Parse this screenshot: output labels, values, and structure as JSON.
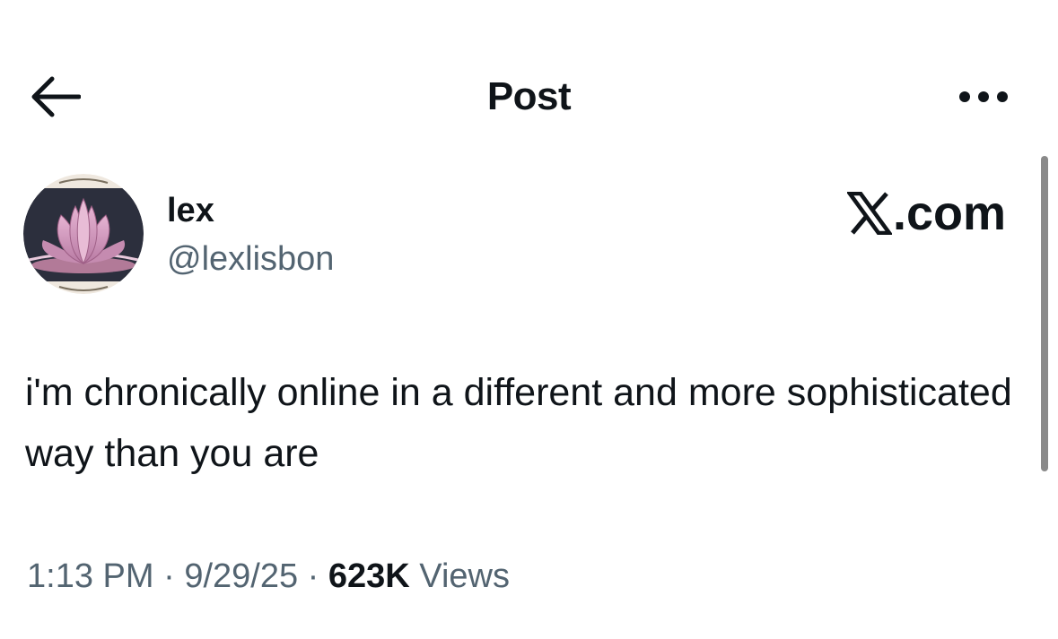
{
  "header": {
    "title": "Post",
    "back_icon": "arrow-left-icon",
    "more_icon": "more-horizontal-icon"
  },
  "author": {
    "display_name": "lex",
    "handle": "@lexlisbon",
    "avatar_icon": "lotus-avatar"
  },
  "watermark": {
    "logo": "x-logo-icon",
    "text": ".com"
  },
  "post": {
    "text": "i'm chronically online in a different and more sophisticated way than you are"
  },
  "meta": {
    "time": "1:13 PM",
    "separator1": " · ",
    "date": "9/29/25",
    "separator2": " · ",
    "views_count": "623K",
    "views_label": " Views"
  },
  "colors": {
    "text_primary": "#0f1419",
    "text_secondary": "#536471",
    "background": "#ffffff"
  }
}
